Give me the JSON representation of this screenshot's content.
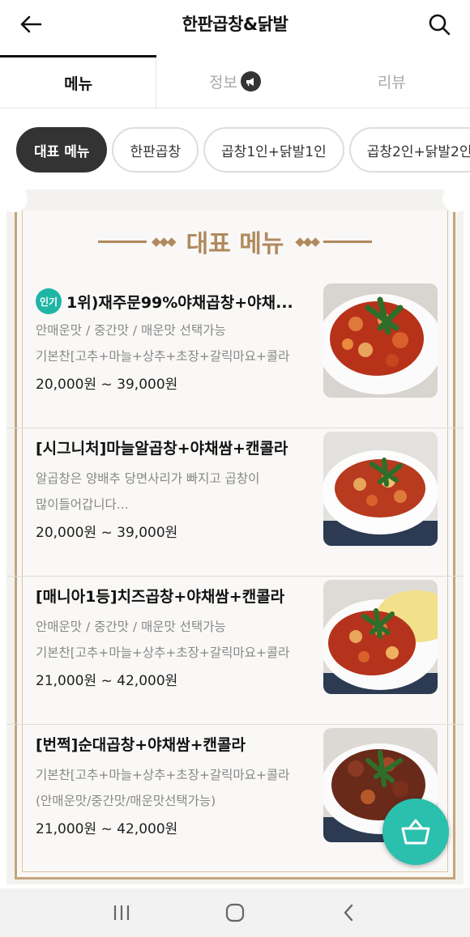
{
  "header": {
    "title": "한판곱창&닭발",
    "back_icon": "arrow-left-icon",
    "search_icon": "search-icon"
  },
  "tabs": [
    {
      "label": "메뉴",
      "active": true
    },
    {
      "label": "정보",
      "active": false,
      "badge_icon": "megaphone-icon"
    },
    {
      "label": "리뷰",
      "active": false
    }
  ],
  "chips": [
    {
      "label": "대표 메뉴",
      "active": true
    },
    {
      "label": "한판곱창",
      "active": false
    },
    {
      "label": "곱창1인+닭발1인",
      "active": false
    },
    {
      "label": "곱창2인+닭발2인",
      "active": false
    }
  ],
  "section": {
    "title": "대표 메뉴",
    "ornament": "◆◆◆"
  },
  "items": [
    {
      "popular_badge": "인기",
      "name": "1위)재주문99%야채곱창+야채...",
      "desc1": "안매운맛 / 중간맛 / 매운맛 선택가능",
      "desc2": "기본찬[고추+마늘+상추+초장+갈릭마요+콜라",
      "price": "20,000원 ~ 39,000원"
    },
    {
      "name": "[시그니처]마늘알곱창+야채쌈+캔콜라",
      "desc1": "알곱창은 양배추 당면사리가 빠지고 곱창이",
      "desc2": "많이들어갑니다...",
      "price": "20,000원 ~ 39,000원"
    },
    {
      "name": "[매니아1등]치즈곱창+야채쌈+캔콜라",
      "desc1": "안매운맛 / 중간맛 / 매운맛 선택가능",
      "desc2": "기본찬[고추+마늘+상추+초장+갈릭마요+콜라",
      "price": "21,000원 ~ 42,000원"
    },
    {
      "name": "[번쩍]순대곱창+야채쌈+캔콜라",
      "desc1": "기본찬[고추+마늘+상추+초장+갈릭마요+콜라",
      "desc2": "(안매운맛/중간맛/매운맛선택가능)",
      "price": "21,000원 ~ 42,000원"
    }
  ],
  "fab": {
    "icon": "basket-icon"
  },
  "system_nav": {
    "recents_icon": "recents-icon",
    "home_icon": "home-icon",
    "back_icon": "back-chevron-icon"
  },
  "colors": {
    "accent": "#2bbfae",
    "gold": "#b08a5e",
    "dark": "#333333"
  }
}
